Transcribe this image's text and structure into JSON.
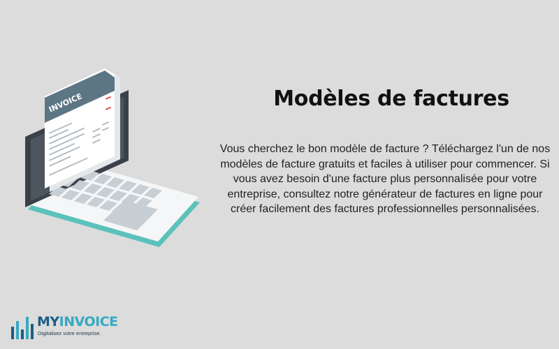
{
  "page": {
    "title": "Modèles de factures",
    "description": "Vous cherchez le bon modèle de facture ? Téléchargez l'un de nos modèles de facture gratuits et faciles à utiliser pour commencer. Si vous avez besoin d'une facture plus personnalisée pour votre entreprise, consultez notre générateur de factures en ligne pour créer facilement des factures professionnelles personnalisées."
  },
  "illustration": {
    "invoice_label": "INVOICE",
    "icon": "laptop-invoice-illustration"
  },
  "logo": {
    "word_my": "MY",
    "word_invoice": "INVOICE",
    "tagline": "Digitalisez votre entreprise.",
    "icon": "bar-chart-logo-icon"
  },
  "colors": {
    "background": "#dcdcdc",
    "title_text": "#111111",
    "body_text": "#222222",
    "brand_dark": "#1b5e84",
    "brand_light": "#36a9c4",
    "laptop_frame": "#3a4149",
    "laptop_body": "#f4f6f7",
    "laptop_teal_edge": "#5bc1bb",
    "invoice_header": "#5d7684",
    "invoice_accent": "#e0504e"
  }
}
